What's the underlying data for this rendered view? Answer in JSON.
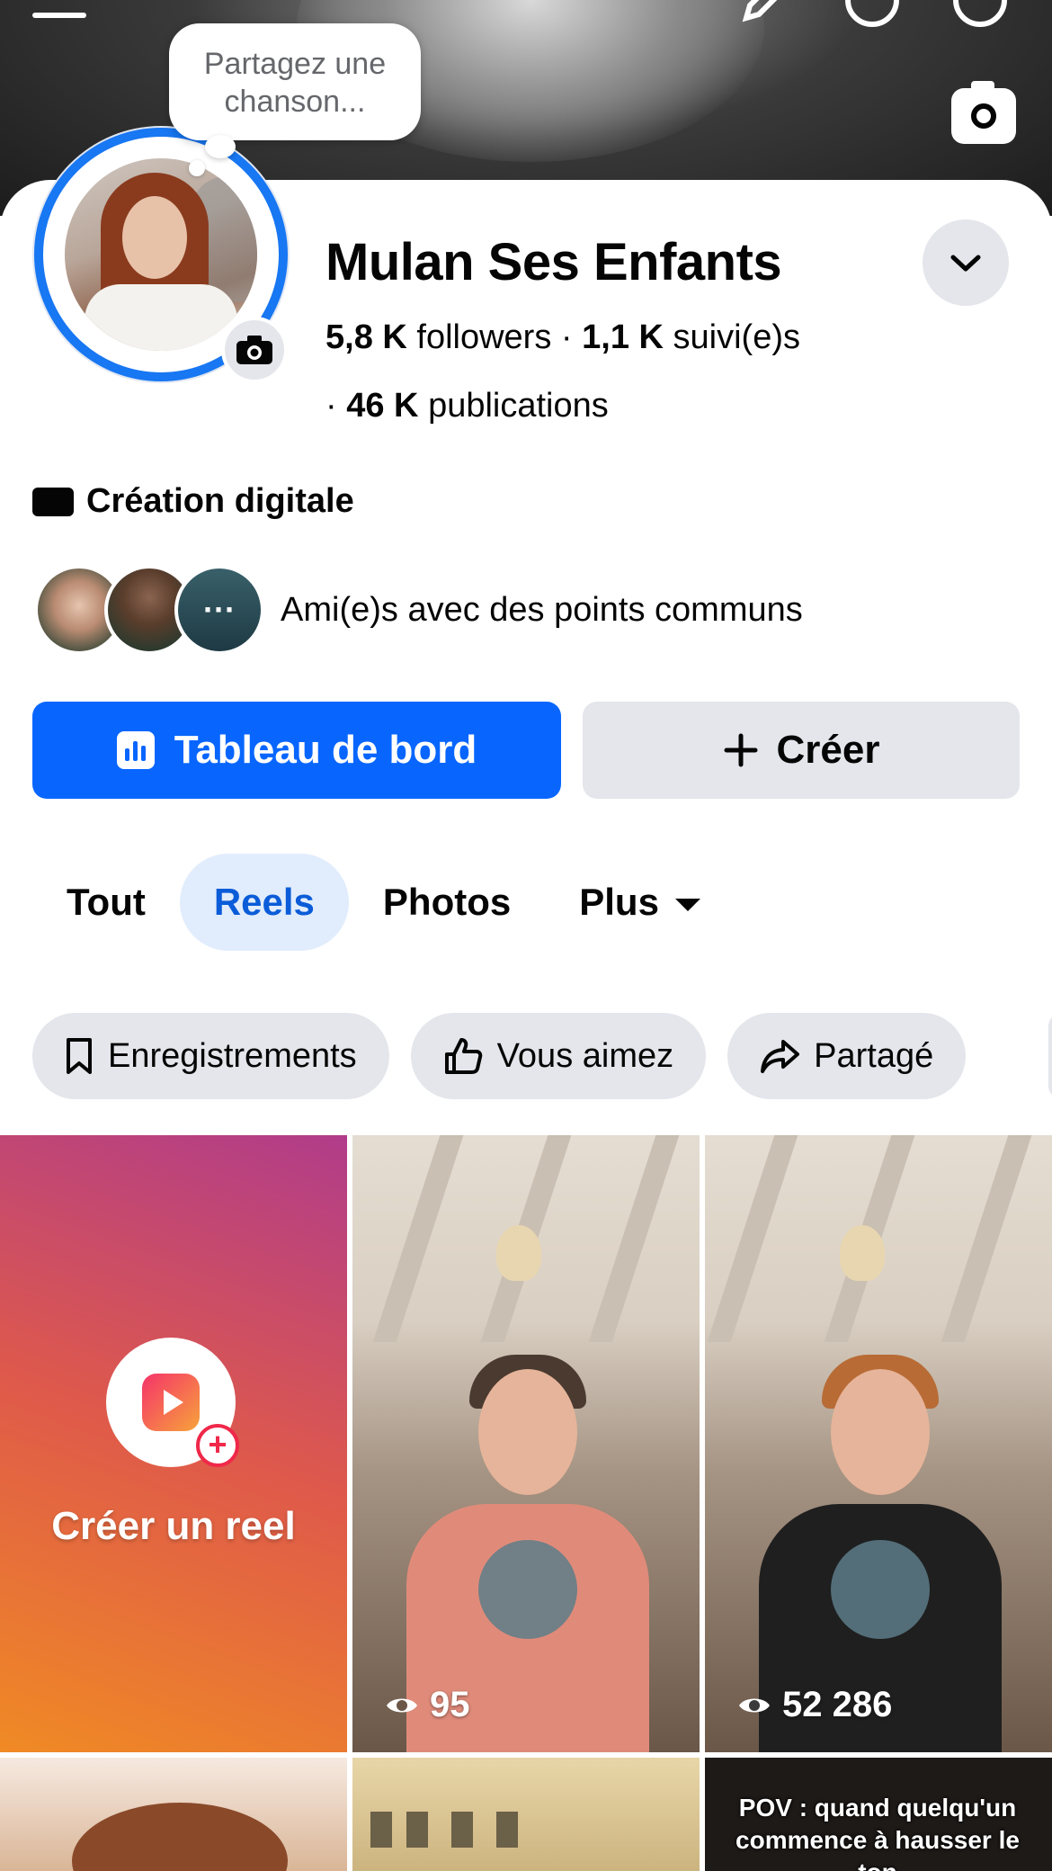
{
  "note": {
    "text": "Partagez une chanson..."
  },
  "profile": {
    "name": "Mulan Ses Enfants",
    "followers_count": "5,8 K",
    "followers_label": "followers",
    "following_count": "1,1 K",
    "following_label": "suivi(e)s",
    "posts_count": "46 K",
    "posts_label": "publications",
    "category": "Création digitale"
  },
  "mutual": {
    "text": "Ami(e)s avec des points communs",
    "more": "···"
  },
  "actions": {
    "dashboard": "Tableau de bord",
    "create": "Créer"
  },
  "tabs": [
    "Tout",
    "Reels",
    "Photos",
    "Plus"
  ],
  "active_tab": "Reels",
  "chips": [
    "Enregistrements",
    "Vous aimez",
    "Partagé"
  ],
  "reels": {
    "create_label": "Créer un reel",
    "items": [
      {
        "views": "95"
      },
      {
        "views": "52 286"
      }
    ],
    "bottom_caption": "POV : quand quelqu'un commence à hausser le ton"
  },
  "colors": {
    "primary": "#0866ff",
    "chip_bg": "#e4e6eb",
    "active_tab_bg": "#e1edfc",
    "active_tab_text": "#0b5cd8"
  }
}
